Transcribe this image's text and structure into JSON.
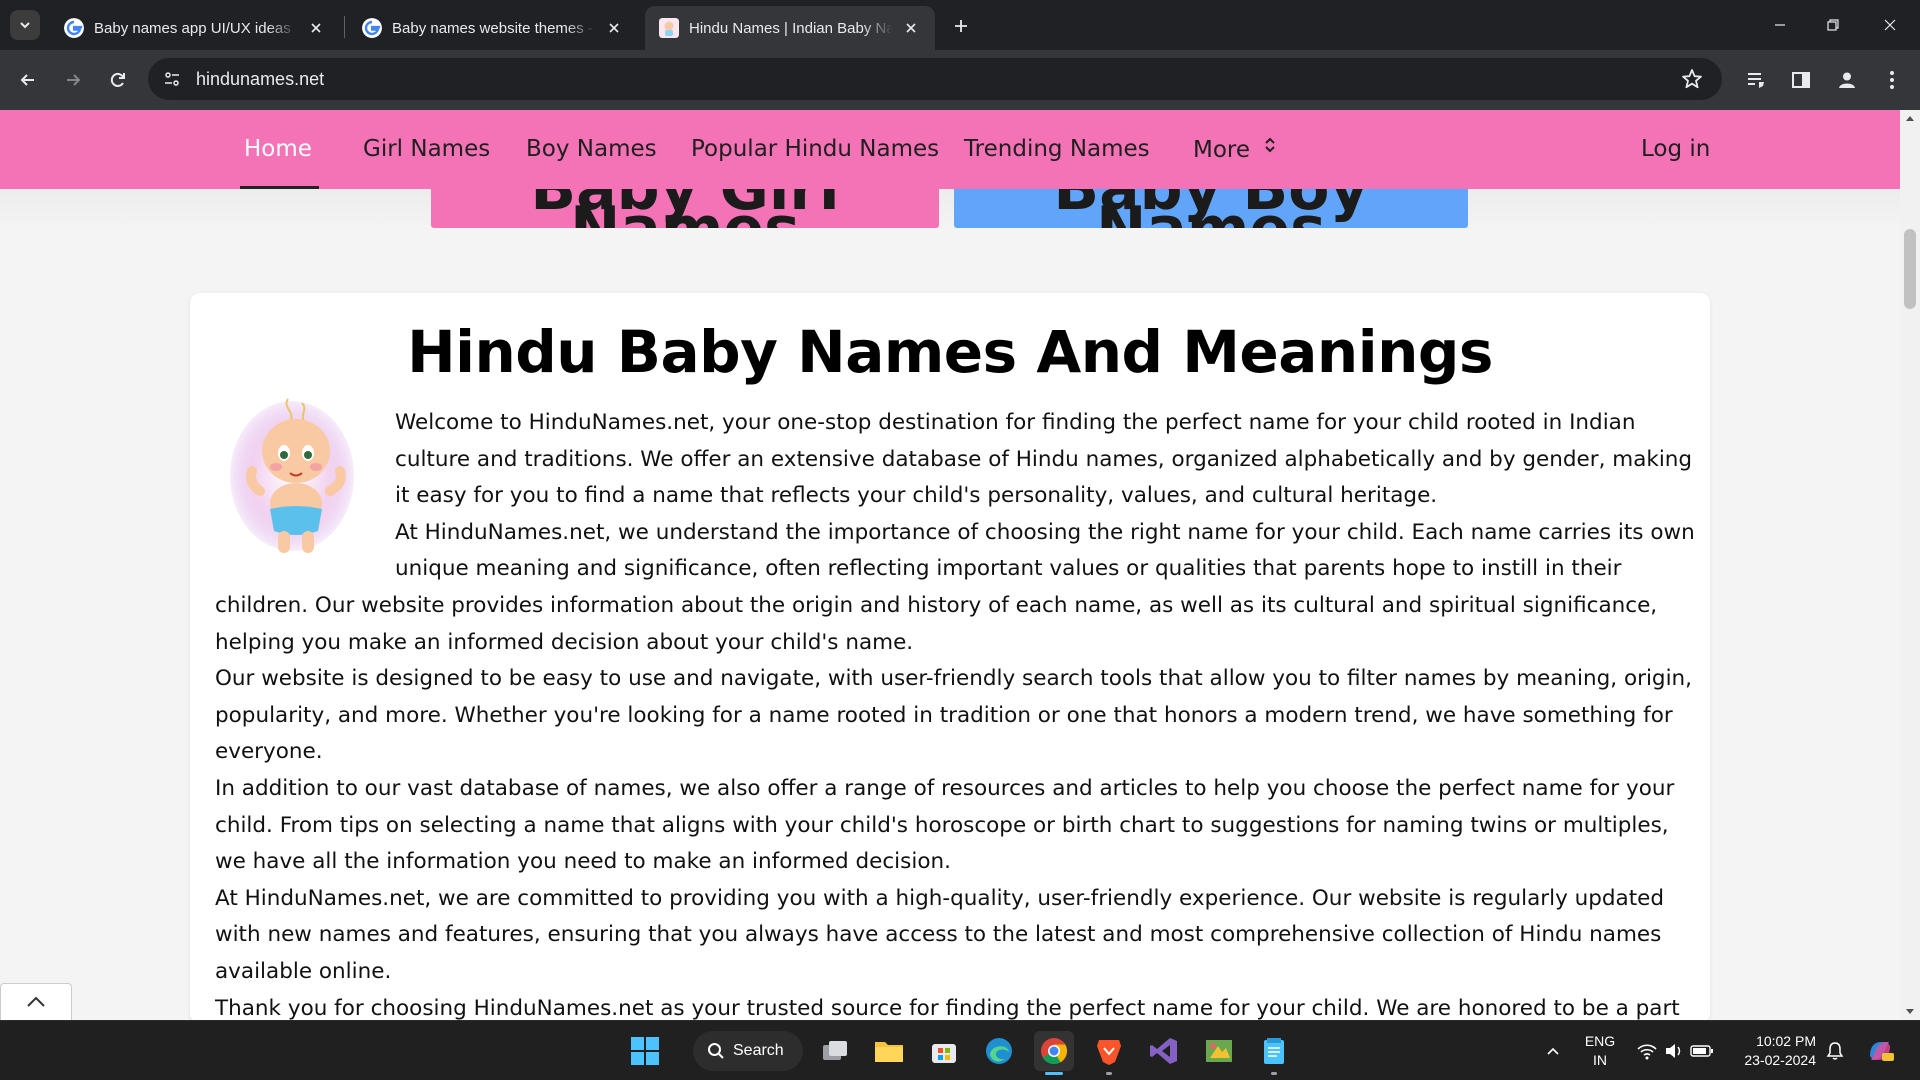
{
  "browser": {
    "tabs": [
      {
        "title": "Baby names app UI/UX ideas - G",
        "active": false
      },
      {
        "title": "Baby names website themes - G",
        "active": false
      },
      {
        "title": "Hindu Names | Indian Baby Nam",
        "active": true
      }
    ],
    "url": "hindunames.net",
    "icons": [
      "tab-search-icon",
      "google-favicon",
      "close-icon",
      "plus-icon",
      "minimize-icon",
      "restore-icon",
      "close-window-icon",
      "back-arrow-icon",
      "forward-arrow-icon",
      "reload-icon",
      "site-info-icon",
      "bookmark-star-icon",
      "reading-list-icon",
      "side-panel-icon",
      "profile-icon",
      "kebab-menu-icon"
    ]
  },
  "site": {
    "nav": {
      "items": [
        "Home",
        "Girl Names",
        "Boy Names",
        "Popular Hindu Names",
        "Trending Names",
        "More"
      ],
      "login": "Log in"
    },
    "hero": {
      "girl_button": "Baby Girl Names",
      "boy_button": "Baby Boy Names",
      "girl_color": "#f472b6",
      "boy_color": "#60a5fa"
    },
    "title": "Hindu Baby Names And Meanings",
    "paragraphs": [
      "Welcome to HinduNames.net, your one-stop destination for finding the perfect name for your child rooted in Indian culture and traditions. We offer an extensive database of Hindu names, organized alphabetically and by gender, making it easy for you to find a name that reflects your child's personality, values, and cultural heritage.",
      "At HinduNames.net, we understand the importance of choosing the right name for your child. Each name carries its own unique meaning and significance, often reflecting important values or qualities that parents hope to instill in their children. Our website provides information about the origin and history of each name, as well as its cultural and spiritual significance, helping you make an informed decision about your child's name.",
      "Our website is designed to be easy to use and navigate, with user-friendly search tools that allow you to filter names by meaning, origin, popularity, and more. Whether you're looking for a name rooted in tradition or one that honors a modern trend, we have something for everyone.",
      "In addition to our vast database of names, we also offer a range of resources and articles to help you choose the perfect name for your child. From tips on selecting a name that aligns with your child's horoscope or birth chart to suggestions for naming twins or multiples, we have all the information you need to make an informed decision.",
      "At HinduNames.net, we are committed to providing you with a high-quality, user-friendly experience. Our website is regularly updated with new names and features, ensuring that you always have access to the latest and most comprehensive collection of Hindu names available online.",
      "Thank you for choosing HinduNames.net as your trusted source for finding the perfect name for your child. We are honored to be a part of this special moment in your family's life and look forward to helping you find a name that reflects your child's unique identity and personality."
    ],
    "accent": "#f472b6"
  },
  "taskbar": {
    "search_label": "Search",
    "language": "ENG",
    "region": "IN",
    "time": "10:02 PM",
    "date": "23-02-2024",
    "apps": [
      "start-icon",
      "task-view-icon",
      "file-explorer-icon",
      "store-icon",
      "edge-icon",
      "chrome-icon",
      "brave-icon",
      "visual-studio-icon",
      "app-icon",
      "notepad-icon"
    ]
  }
}
